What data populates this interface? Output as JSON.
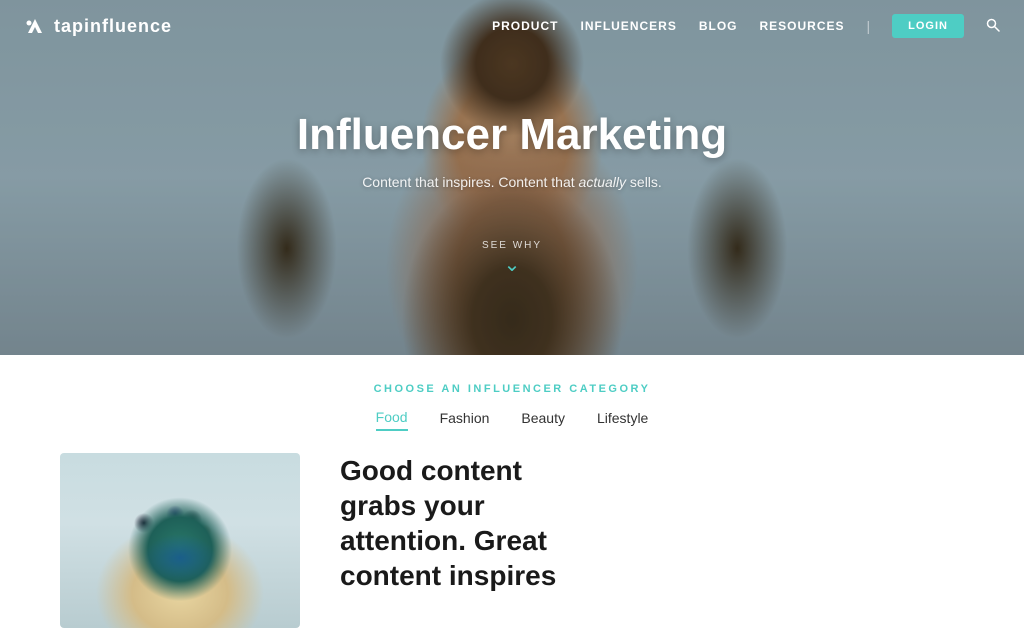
{
  "navbar": {
    "logo_text": "tapinfluence",
    "links": [
      {
        "label": "PRODUCT",
        "href": "#"
      },
      {
        "label": "INFLUENCERS",
        "href": "#"
      },
      {
        "label": "BLOG",
        "href": "#"
      },
      {
        "label": "RESOURCES",
        "href": "#"
      }
    ],
    "login_label": "LOGIN",
    "search_icon": "🔍"
  },
  "hero": {
    "title": "Influencer Marketing",
    "subtitle_prefix": "Content that inspires. Content that ",
    "subtitle_italic": "actually",
    "subtitle_suffix": " sells.",
    "see_why": "SEE WHY",
    "chevron": "⌄"
  },
  "category_section": {
    "label": "CHOOSE AN INFLUENCER CATEGORY",
    "tabs": [
      {
        "label": "Food",
        "active": true
      },
      {
        "label": "Fashion",
        "active": false
      },
      {
        "label": "Beauty",
        "active": false
      },
      {
        "label": "Lifestyle",
        "active": false
      }
    ]
  },
  "content": {
    "title_line1": "Good content",
    "title_line2": "grabs your",
    "title_line3": "attention. Great",
    "title_line4": "content inspires"
  }
}
